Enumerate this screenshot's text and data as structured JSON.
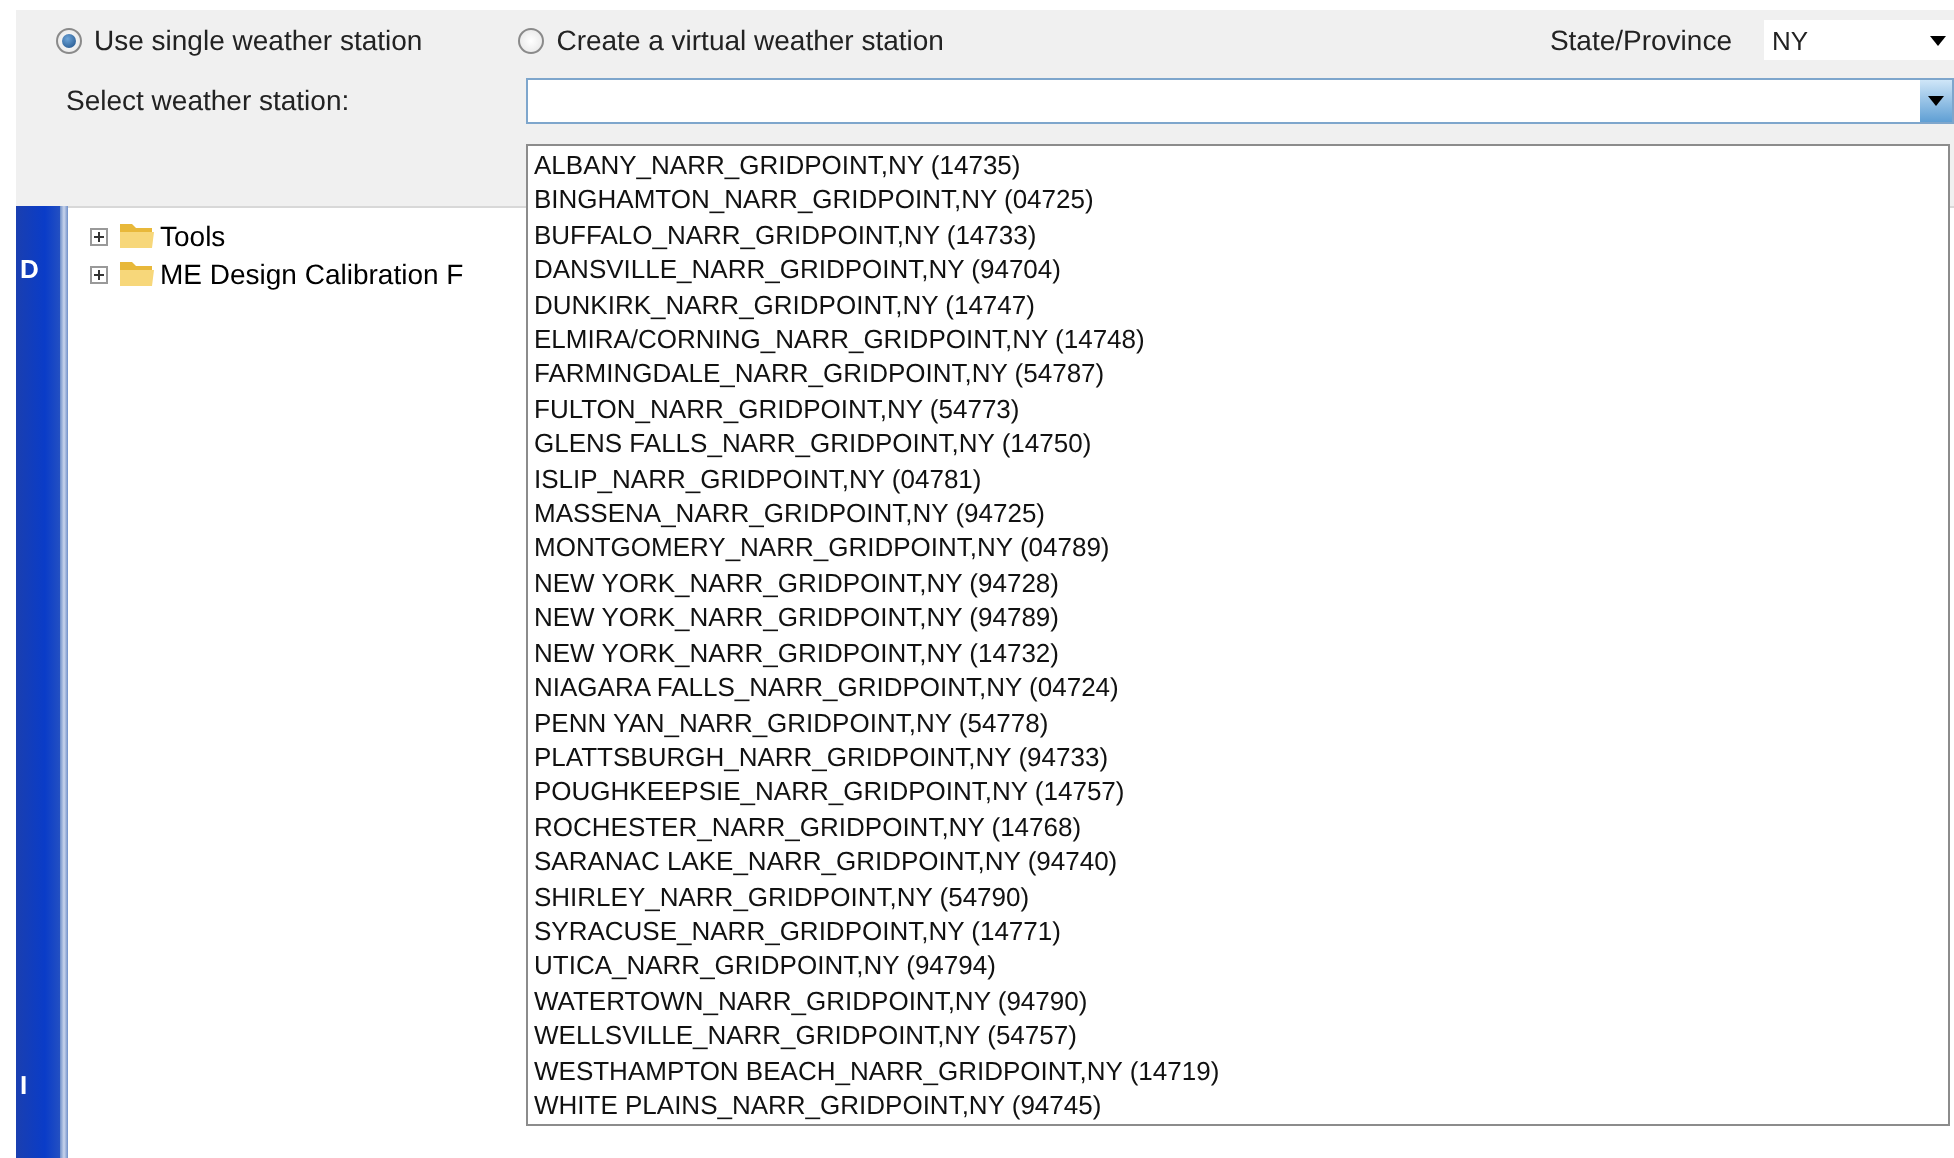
{
  "station_mode": [
    {
      "label": "Use single weather station",
      "selected": true
    },
    {
      "label": "Create a virtual weather station",
      "selected": false
    }
  ],
  "state_label": "State/Province",
  "state_value": "NY",
  "select_label": "Select weather station:",
  "side_tab_letters": [
    "D",
    "I"
  ],
  "tree": [
    {
      "label": "Tools",
      "expanded": false
    },
    {
      "label": "ME Design Calibration F",
      "expanded": false
    }
  ],
  "station_list": [
    "ALBANY_NARR_GRIDPOINT,NY (14735)",
    "BINGHAMTON_NARR_GRIDPOINT,NY (04725)",
    "BUFFALO_NARR_GRIDPOINT,NY (14733)",
    "DANSVILLE_NARR_GRIDPOINT,NY (94704)",
    "DUNKIRK_NARR_GRIDPOINT,NY (14747)",
    "ELMIRA/CORNING_NARR_GRIDPOINT,NY (14748)",
    "FARMINGDALE_NARR_GRIDPOINT,NY (54787)",
    "FULTON_NARR_GRIDPOINT,NY (54773)",
    "GLENS FALLS_NARR_GRIDPOINT,NY (14750)",
    "ISLIP_NARR_GRIDPOINT,NY (04781)",
    "MASSENA_NARR_GRIDPOINT,NY (94725)",
    "MONTGOMERY_NARR_GRIDPOINT,NY (04789)",
    "NEW YORK_NARR_GRIDPOINT,NY (94728)",
    "NEW YORK_NARR_GRIDPOINT,NY (94789)",
    "NEW YORK_NARR_GRIDPOINT,NY (14732)",
    "NIAGARA FALLS_NARR_GRIDPOINT,NY (04724)",
    "PENN YAN_NARR_GRIDPOINT,NY (54778)",
    "PLATTSBURGH_NARR_GRIDPOINT,NY (94733)",
    "POUGHKEEPSIE_NARR_GRIDPOINT,NY (14757)",
    "ROCHESTER_NARR_GRIDPOINT,NY (14768)",
    "SARANAC LAKE_NARR_GRIDPOINT,NY (94740)",
    "SHIRLEY_NARR_GRIDPOINT,NY (54790)",
    "SYRACUSE_NARR_GRIDPOINT,NY (14771)",
    "UTICA_NARR_GRIDPOINT,NY (94794)",
    "WATERTOWN_NARR_GRIDPOINT,NY (94790)",
    "WELLSVILLE_NARR_GRIDPOINT,NY (54757)",
    "WESTHAMPTON BEACH_NARR_GRIDPOINT,NY (14719)",
    "WHITE PLAINS_NARR_GRIDPOINT,NY (94745)"
  ]
}
